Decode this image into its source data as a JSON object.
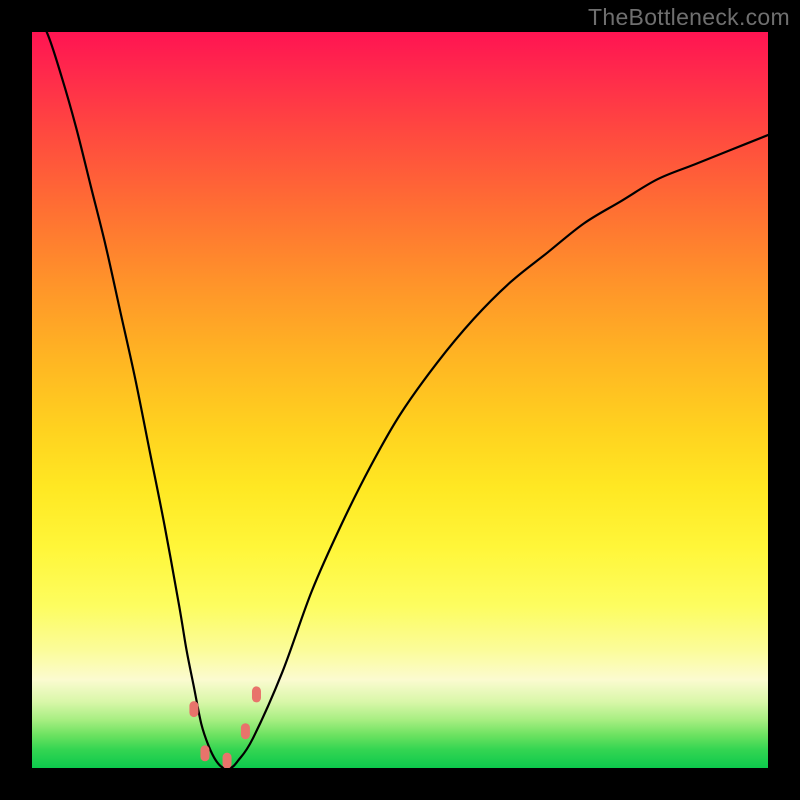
{
  "attribution": "TheBottleneck.com",
  "chart_data": {
    "type": "line",
    "title": "",
    "xlabel": "",
    "ylabel": "",
    "xlim": [
      0,
      100
    ],
    "ylim": [
      0,
      100
    ],
    "series": [
      {
        "name": "bottleneck-curve",
        "x": [
          0,
          2,
          4,
          6,
          8,
          10,
          12,
          14,
          16,
          18,
          20,
          21,
          22,
          23,
          24,
          25,
          26,
          27,
          28,
          30,
          34,
          38,
          42,
          46,
          50,
          55,
          60,
          65,
          70,
          75,
          80,
          85,
          90,
          95,
          100
        ],
        "y": [
          103,
          100,
          94,
          87,
          79,
          71,
          62,
          53,
          43,
          33,
          22,
          16,
          11,
          6,
          3,
          1,
          0,
          0,
          1,
          4,
          13,
          24,
          33,
          41,
          48,
          55,
          61,
          66,
          70,
          74,
          77,
          80,
          82,
          84,
          86
        ]
      }
    ],
    "markers": [
      {
        "name": "trough-left",
        "x": 22.0,
        "y": 8,
        "color": "#e8736b"
      },
      {
        "name": "trough-bottomL",
        "x": 23.5,
        "y": 2,
        "color": "#e8736b"
      },
      {
        "name": "trough-bottomR",
        "x": 26.5,
        "y": 1,
        "color": "#e8736b"
      },
      {
        "name": "trough-right",
        "x": 29.0,
        "y": 5,
        "color": "#e8736b"
      },
      {
        "name": "trough-right2",
        "x": 30.5,
        "y": 10,
        "color": "#e8736b"
      }
    ],
    "background_gradient": {
      "0": "#ff1452",
      "50": "#ffd21f",
      "78": "#fdfd60",
      "100": "#0cc94c"
    }
  }
}
